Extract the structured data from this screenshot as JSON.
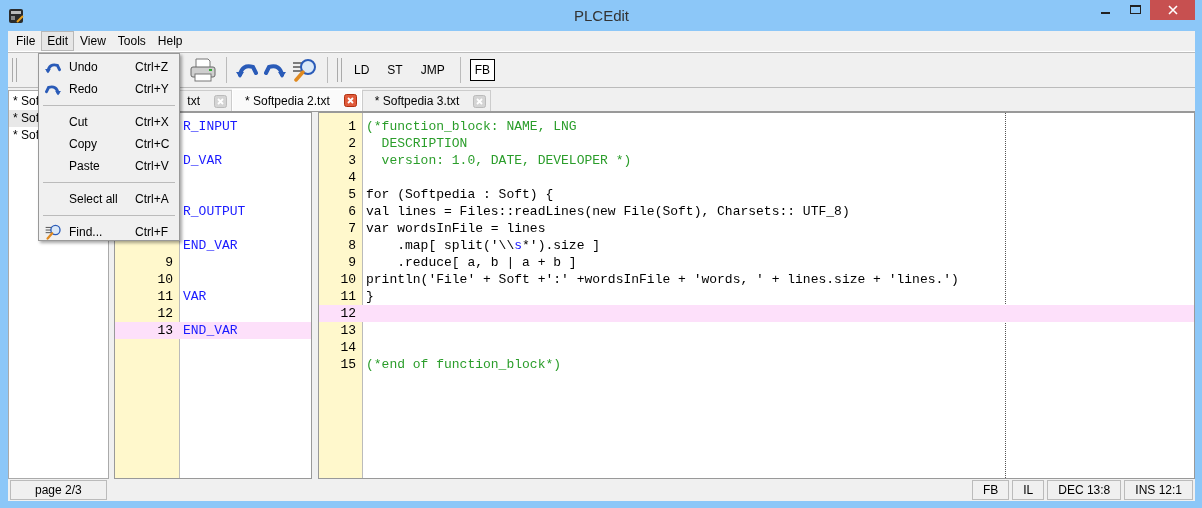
{
  "window": {
    "title": "PLCEdit"
  },
  "menu_bar": [
    {
      "label": "File",
      "selected": false
    },
    {
      "label": "Edit",
      "selected": true
    },
    {
      "label": "View",
      "selected": false
    },
    {
      "label": "Tools",
      "selected": false
    },
    {
      "label": "Help",
      "selected": false
    }
  ],
  "edit_menu": [
    {
      "kind": "undo",
      "label": "Undo",
      "shortcut": "Ctrl+Z"
    },
    {
      "kind": "redo",
      "label": "Redo",
      "shortcut": "Ctrl+Y"
    },
    {
      "kind": "separator"
    },
    {
      "kind": "plain",
      "label": "Cut",
      "shortcut": "Ctrl+X"
    },
    {
      "kind": "plain",
      "label": "Copy",
      "shortcut": "Ctrl+C"
    },
    {
      "kind": "plain",
      "label": "Paste",
      "shortcut": "Ctrl+V"
    },
    {
      "kind": "separator"
    },
    {
      "kind": "plain",
      "label": "Select all",
      "shortcut": "Ctrl+A"
    },
    {
      "kind": "separator"
    },
    {
      "kind": "find",
      "label": "Find...",
      "shortcut": "Ctrl+F"
    }
  ],
  "toolbar": {
    "language_buttons": [
      "LD",
      "ST",
      "JMP"
    ],
    "fb_button": "FB"
  },
  "file_list": [
    {
      "label": "* Sof",
      "selected": false
    },
    {
      "label": "* Sof",
      "selected": true
    },
    {
      "label": "* Sof",
      "selected": false
    }
  ],
  "tabs": [
    {
      "label": "txt",
      "selected": false
    },
    {
      "label": "* Softpedia 2.txt",
      "selected": true
    },
    {
      "label": "* Softpedia 3.txt",
      "selected": false
    }
  ],
  "left_editor": {
    "lines": [
      {
        "segments": [
          {
            "kind": "keyword",
            "text": "R_INPUT"
          }
        ],
        "selected": false
      },
      {
        "selected": false
      },
      {
        "segments": [
          {
            "kind": "keyword",
            "text": "D_VAR"
          }
        ],
        "selected": false
      },
      {
        "selected": false
      },
      {
        "selected": false
      },
      {
        "segments": [
          {
            "kind": "keyword",
            "text": "R_OUTPUT"
          }
        ],
        "selected": false
      },
      {
        "selected": false
      },
      {
        "segments": [
          {
            "kind": "keyword",
            "text": "END_VAR"
          }
        ],
        "selected": false
      },
      {
        "number": "9",
        "selected": false
      },
      {
        "number": "10",
        "selected": false
      },
      {
        "number": "11",
        "segments": [
          {
            "kind": "keyword",
            "text": "VAR"
          }
        ],
        "selected": false
      },
      {
        "number": "12",
        "selected": false
      },
      {
        "number": "13",
        "segments": [
          {
            "kind": "keyword",
            "text": "END_VAR"
          }
        ],
        "selected": true
      }
    ]
  },
  "right_editor": {
    "lines": [
      {
        "number": "1",
        "segments": [
          {
            "kind": "comment",
            "text": "(*function_block: NAME, LNG"
          }
        ],
        "selected": false
      },
      {
        "number": "2",
        "segments": [
          {
            "kind": "comment",
            "text": "  DESCRIPTION"
          }
        ],
        "selected": false
      },
      {
        "number": "3",
        "segments": [
          {
            "kind": "comment",
            "text": "  version: 1.0, DATE, DEVELOPER *)"
          }
        ],
        "selected": false
      },
      {
        "number": "4",
        "selected": false
      },
      {
        "number": "5",
        "segments": [
          {
            "kind": "plain",
            "text": "for (Softpedia : Soft) {"
          }
        ],
        "selected": false
      },
      {
        "number": "6",
        "segments": [
          {
            "kind": "plain",
            "text": "val lines = Files::readLines(new File(Soft), Charsets:: UTF_8)"
          }
        ],
        "selected": false
      },
      {
        "number": "7",
        "segments": [
          {
            "kind": "plain",
            "text": "var wordsInFile = lines"
          }
        ],
        "selected": false
      },
      {
        "number": "8",
        "segments": [
          {
            "kind": "plain",
            "text": "    .map[ split('\\\\"
          },
          {
            "kind": "escape",
            "text": "s"
          },
          {
            "kind": "plain",
            "text": "*').size ]"
          }
        ],
        "selected": false
      },
      {
        "number": "9",
        "segments": [
          {
            "kind": "plain",
            "text": "    .reduce[ a, b | a + b ]"
          }
        ],
        "selected": false
      },
      {
        "number": "10",
        "segments": [
          {
            "kind": "plain",
            "text": "println('File' + Soft +':' +wordsInFile + 'words, ' + lines.size + 'lines.')"
          }
        ],
        "selected": false
      },
      {
        "number": "11",
        "segments": [
          {
            "kind": "plain",
            "text": "}"
          }
        ],
        "selected": false
      },
      {
        "number": "12",
        "selected": true
      },
      {
        "number": "13",
        "selected": false
      },
      {
        "number": "14",
        "selected": false
      },
      {
        "number": "15",
        "segments": [
          {
            "kind": "comment",
            "text": "(*end of function_block*)"
          }
        ],
        "selected": false
      }
    ]
  },
  "status_bar": {
    "page": "page 2/3",
    "fields": [
      "FB",
      "IL",
      "DEC 13:8",
      "INS 12:1"
    ]
  }
}
